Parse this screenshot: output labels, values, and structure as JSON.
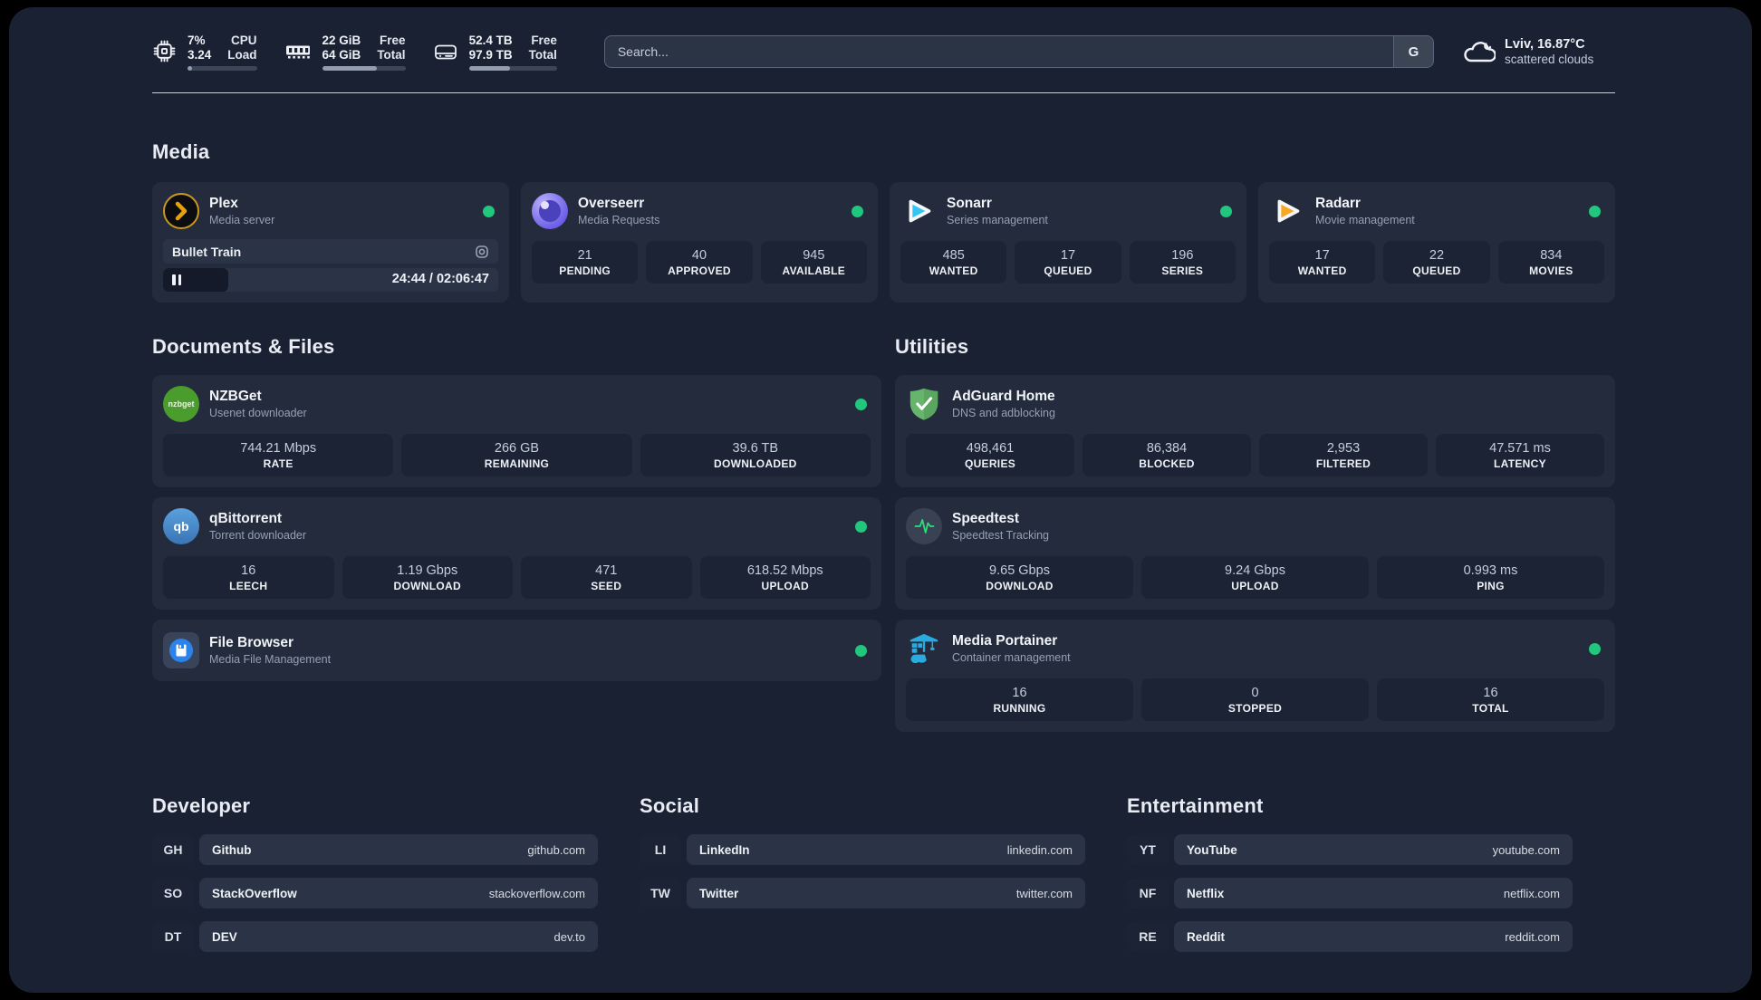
{
  "header": {
    "system": {
      "cpu": {
        "icon": "cpu-chip-icon",
        "value_top": "7%",
        "value_bottom": "3.24",
        "label_top": "CPU",
        "label_bottom": "Load",
        "progress_pct": 7
      },
      "memory": {
        "icon": "ram-icon",
        "value_top": "22 GiB",
        "value_bottom": "64 GiB",
        "label_top": "Free",
        "label_bottom": "Total",
        "progress_pct": 66
      },
      "disk": {
        "icon": "hard-drive-icon",
        "value_top": "52.4 TB",
        "value_bottom": "97.9 TB",
        "label_top": "Free",
        "label_bottom": "Total",
        "progress_pct": 47
      }
    },
    "search": {
      "placeholder": "Search...",
      "engine_button": "G"
    },
    "weather": {
      "icon": "cloud-icon",
      "location": "Lviv, 16.87°C",
      "condition": "scattered clouds"
    }
  },
  "sections": {
    "media": {
      "title": "Media"
    },
    "documents": {
      "title": "Documents & Files"
    },
    "utilities": {
      "title": "Utilities"
    },
    "developer": {
      "title": "Developer"
    },
    "social": {
      "title": "Social"
    },
    "entertainment": {
      "title": "Entertainment"
    }
  },
  "apps": {
    "plex": {
      "icon": "plex-icon",
      "name": "Plex",
      "description": "Media server",
      "status": "online",
      "now_playing": {
        "title": "Bullet Train",
        "time_display": "24:44 / 02:06:47",
        "progress_pct": 19.5
      }
    },
    "overseerr": {
      "icon": "overseerr-icon",
      "name": "Overseerr",
      "description": "Media Requests",
      "status": "online",
      "stats": [
        {
          "value": "21",
          "label": "PENDING"
        },
        {
          "value": "40",
          "label": "APPROVED"
        },
        {
          "value": "945",
          "label": "AVAILABLE"
        }
      ]
    },
    "sonarr": {
      "icon": "sonarr-icon",
      "name": "Sonarr",
      "description": "Series management",
      "status": "online",
      "stats": [
        {
          "value": "485",
          "label": "WANTED"
        },
        {
          "value": "17",
          "label": "QUEUED"
        },
        {
          "value": "196",
          "label": "SERIES"
        }
      ]
    },
    "radarr": {
      "icon": "radarr-icon",
      "name": "Radarr",
      "description": "Movie management",
      "status": "online",
      "stats": [
        {
          "value": "17",
          "label": "WANTED"
        },
        {
          "value": "22",
          "label": "QUEUED"
        },
        {
          "value": "834",
          "label": "MOVIES"
        }
      ]
    },
    "nzbget": {
      "icon": "nzbget-icon",
      "icon_text": "nzbget",
      "name": "NZBGet",
      "description": "Usenet downloader",
      "status": "online",
      "stats": [
        {
          "value": "744.21 Mbps",
          "label": "RATE"
        },
        {
          "value": "266 GB",
          "label": "REMAINING"
        },
        {
          "value": "39.6 TB",
          "label": "DOWNLOADED"
        }
      ]
    },
    "qbittorrent": {
      "icon": "qbittorrent-icon",
      "icon_text": "qb",
      "name": "qBittorrent",
      "description": "Torrent downloader",
      "status": "online",
      "stats": [
        {
          "value": "16",
          "label": "LEECH"
        },
        {
          "value": "1.19 Gbps",
          "label": "DOWNLOAD"
        },
        {
          "value": "471",
          "label": "SEED"
        },
        {
          "value": "618.52 Mbps",
          "label": "UPLOAD"
        }
      ]
    },
    "filebrowser": {
      "icon": "file-browser-icon",
      "name": "File Browser",
      "description": "Media File Management",
      "status": "online",
      "stats": []
    },
    "adguard": {
      "icon": "adguard-shield-icon",
      "name": "AdGuard Home",
      "description": "DNS and adblocking",
      "stats": [
        {
          "value": "498,461",
          "label": "QUERIES"
        },
        {
          "value": "86,384",
          "label": "BLOCKED"
        },
        {
          "value": "2,953",
          "label": "FILTERED"
        },
        {
          "value": "47.571 ms",
          "label": "LATENCY"
        }
      ]
    },
    "speedtest": {
      "icon": "speedtest-pulse-icon",
      "name": "Speedtest",
      "description": "Speedtest Tracking",
      "stats": [
        {
          "value": "9.65 Gbps",
          "label": "DOWNLOAD"
        },
        {
          "value": "9.24 Gbps",
          "label": "UPLOAD"
        },
        {
          "value": "0.993 ms",
          "label": "PING"
        }
      ]
    },
    "portainer": {
      "icon": "portainer-crane-icon",
      "name": "Media Portainer",
      "description": "Container management",
      "status": "online",
      "stats": [
        {
          "value": "16",
          "label": "RUNNING"
        },
        {
          "value": "0",
          "label": "STOPPED"
        },
        {
          "value": "16",
          "label": "TOTAL"
        }
      ]
    }
  },
  "links": {
    "developer": {
      "items": [
        {
          "tag": "GH",
          "name": "Github",
          "url": "github.com"
        },
        {
          "tag": "SO",
          "name": "StackOverflow",
          "url": "stackoverflow.com"
        },
        {
          "tag": "DT",
          "name": "DEV",
          "url": "dev.to"
        }
      ]
    },
    "social": {
      "items": [
        {
          "tag": "LI",
          "name": "LinkedIn",
          "url": "linkedin.com"
        },
        {
          "tag": "TW",
          "name": "Twitter",
          "url": "twitter.com"
        }
      ]
    },
    "entertainment": {
      "items": [
        {
          "tag": "YT",
          "name": "YouTube",
          "url": "youtube.com"
        },
        {
          "tag": "NF",
          "name": "Netflix",
          "url": "netflix.com"
        },
        {
          "tag": "RE",
          "name": "Reddit",
          "url": "reddit.com"
        }
      ]
    }
  },
  "colors": {
    "status_online": "#21c77d",
    "plex_gold": "#e5a00d",
    "sonarr_blue": "#35c5f4",
    "radarr_orange": "#f7a823",
    "nzbget_green": "#4a9c2d",
    "qbittorrent_blue": "#4a90d9",
    "adguard_green": "#67b56c",
    "speedtest_green": "#2ee07a",
    "portainer_blue": "#29abe2",
    "filebrowser_blue": "#2c83ea",
    "overseerr_purple": "#6c5ce7"
  }
}
